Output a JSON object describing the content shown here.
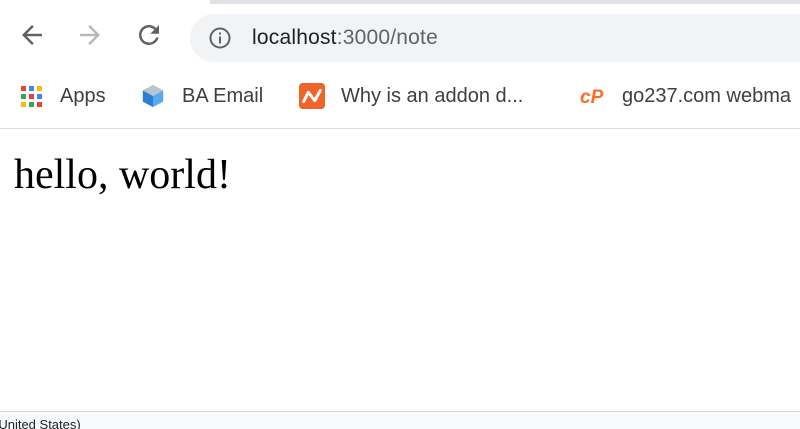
{
  "browser": {
    "url_host": "localhost",
    "url_rest": ":3000/note"
  },
  "bookmarks": [
    {
      "label": "Apps",
      "icon": "apps-grid-icon"
    },
    {
      "label": "BA Email",
      "icon": "ba-cube-icon"
    },
    {
      "label": "Why is an addon d...",
      "icon": "addon-n-icon"
    },
    {
      "label": "go237.com webma",
      "icon": "cpanel-icon"
    }
  ],
  "apps_colors": [
    "#ea4335",
    "#4285f4",
    "#fbbc05",
    "#34a853",
    "#ea4335",
    "#4285f4",
    "#fbbc05",
    "#34a853",
    "#ea4335"
  ],
  "page": {
    "text": "hello, world!"
  },
  "status_bar": {
    "text": "(United States)"
  }
}
